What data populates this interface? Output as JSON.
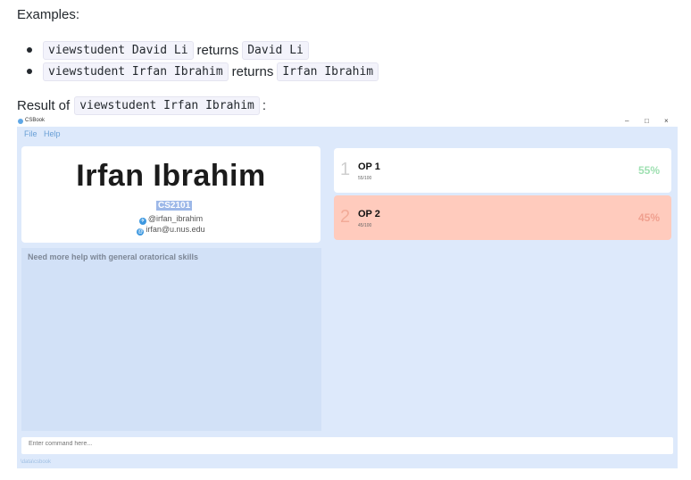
{
  "doc": {
    "examples_heading": "Examples:",
    "bullets": [
      {
        "command": "viewstudent David Li",
        "word": "returns",
        "result": "David Li"
      },
      {
        "command": "viewstudent Irfan Ibrahim",
        "word": "returns",
        "result": "Irfan Ibrahim"
      }
    ],
    "result_prefix": "Result of",
    "result_command": "viewstudent Irfan Ibrahim",
    "result_suffix": ":"
  },
  "app": {
    "title": "CSBook",
    "window_buttons": [
      "–",
      "□",
      "×"
    ],
    "menu": [
      "File",
      "Help"
    ],
    "student": {
      "name": "Irfan Ibrahim",
      "module": "CS2101",
      "telegram": "@irfan_ibrahim",
      "email": "irfan@u.nus.edu",
      "note": "Need more help with general oratorical skills"
    },
    "tests": [
      {
        "index": "1",
        "name": "OP 1",
        "score": "55/100",
        "percent": "55%",
        "color": "#ffffff",
        "accent": "#9fe0b2",
        "index_color": "#cfcfcf"
      },
      {
        "index": "2",
        "name": "OP 2",
        "score": "45/100",
        "percent": "45%",
        "color": "#ffcbbd",
        "accent": "#f0a08f",
        "index_color": "#f2ab98"
      }
    ],
    "command_placeholder": "Enter command here...",
    "status": "\\data\\csbook"
  }
}
